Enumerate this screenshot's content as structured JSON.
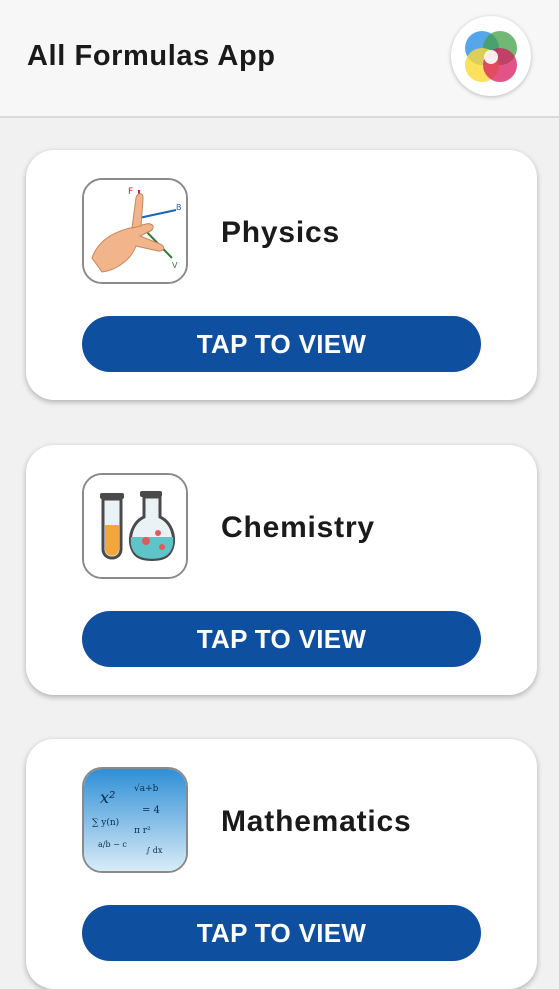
{
  "app": {
    "title": "All Formulas App"
  },
  "subjects": [
    {
      "name": "Physics",
      "button_label": "TAP TO VIEW",
      "icon": "physics-hand-rule-icon"
    },
    {
      "name": "Chemistry",
      "button_label": "TAP TO VIEW",
      "icon": "chemistry-flask-icon"
    },
    {
      "name": "Mathematics",
      "button_label": "TAP TO VIEW",
      "icon": "mathematics-formulas-icon"
    }
  ],
  "colors": {
    "primary": "#0e4fa0",
    "background": "#f1f1f1",
    "card": "#ffffff"
  }
}
